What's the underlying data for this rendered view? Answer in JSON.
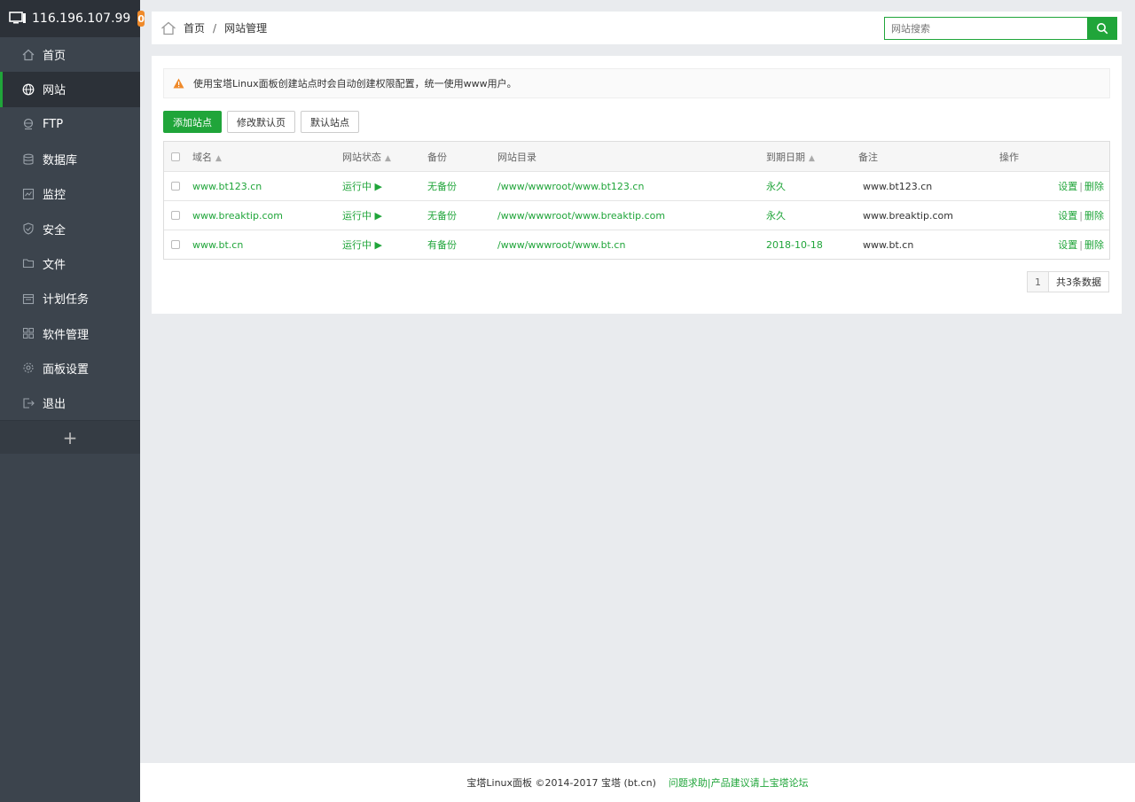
{
  "header": {
    "ip": "116.196.107.99",
    "badge": "0"
  },
  "sidebar": {
    "items": [
      {
        "label": "首页",
        "icon": "home-icon"
      },
      {
        "label": "网站",
        "icon": "globe-icon",
        "active": true
      },
      {
        "label": "FTP",
        "icon": "ftp-icon"
      },
      {
        "label": "数据库",
        "icon": "database-icon"
      },
      {
        "label": "监控",
        "icon": "monitor-icon"
      },
      {
        "label": "安全",
        "icon": "shield-icon"
      },
      {
        "label": "文件",
        "icon": "folder-icon"
      },
      {
        "label": "计划任务",
        "icon": "calendar-icon"
      },
      {
        "label": "软件管理",
        "icon": "grid-icon"
      },
      {
        "label": "面板设置",
        "icon": "gear-icon"
      },
      {
        "label": "退出",
        "icon": "logout-icon"
      }
    ],
    "add_label": "+"
  },
  "breadcrumb": {
    "home": "首页",
    "separator": "/",
    "current": "网站管理"
  },
  "search": {
    "placeholder": "网站搜索"
  },
  "alert": {
    "text": "使用宝塔Linux面板创建站点时会自动创建权限配置，统一使用www用户。"
  },
  "toolbar": {
    "add_site": "添加站点",
    "edit_default_page": "修改默认页",
    "default_site": "默认站点"
  },
  "table": {
    "headers": {
      "domain": "域名",
      "status": "网站状态",
      "backup": "备份",
      "root": "网站目录",
      "expire": "到期日期",
      "remark": "备注",
      "ops": "操作"
    },
    "rows": [
      {
        "domain": "www.bt123.cn",
        "status": "运行中",
        "backup": "无备份",
        "root": "/www/wwwroot/www.bt123.cn",
        "expire": "永久",
        "remark": "www.bt123.cn",
        "op_set": "设置",
        "op_sep": "|",
        "op_del": "删除"
      },
      {
        "domain": "www.breaktip.com",
        "status": "运行中",
        "backup": "无备份",
        "root": "/www/wwwroot/www.breaktip.com",
        "expire": "永久",
        "remark": "www.breaktip.com",
        "op_set": "设置",
        "op_sep": "|",
        "op_del": "删除"
      },
      {
        "domain": "www.bt.cn",
        "status": "运行中",
        "backup": "有备份",
        "root": "/www/wwwroot/www.bt.cn",
        "expire": "2018-10-18",
        "remark": "www.bt.cn",
        "op_set": "设置",
        "op_sep": "|",
        "op_del": "删除"
      }
    ]
  },
  "pager": {
    "page": "1",
    "total": "共3条数据"
  },
  "footer": {
    "copyright": "宝塔Linux面板 ©2014-2017 宝塔 (bt.cn)",
    "link": "问题求助|产品建议请上宝塔论坛"
  },
  "colors": {
    "accent": "#20a53a",
    "sidebar_bg": "#3c444d",
    "sidebar_header_bg": "#2c3138",
    "badge": "#ef8a2a"
  }
}
